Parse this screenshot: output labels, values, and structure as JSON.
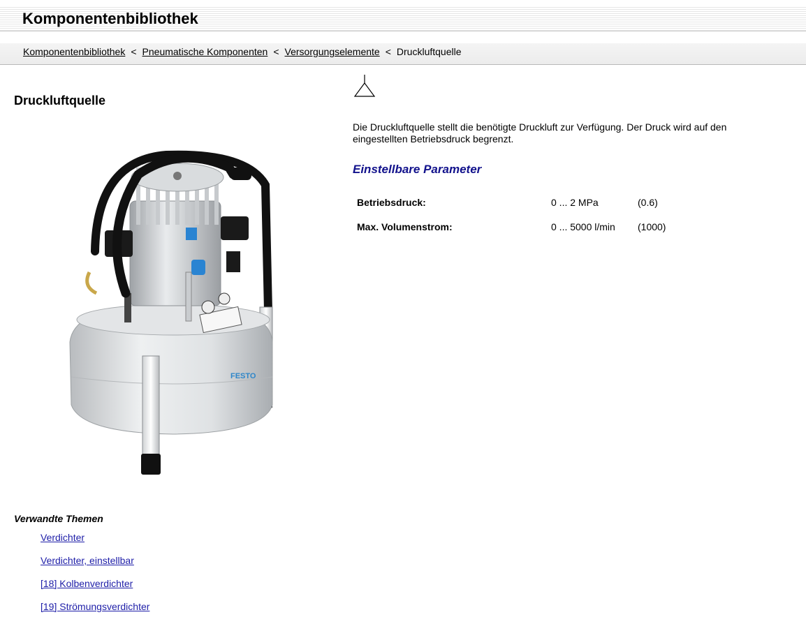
{
  "header": {
    "title": "Komponentenbibliothek"
  },
  "breadcrumb": {
    "items": [
      "Komponentenbibliothek",
      "Pneumatische Komponenten",
      "Versorgungselemente"
    ],
    "separator": "<",
    "current": "Druckluftquelle"
  },
  "page": {
    "title": "Druckluftquelle",
    "image_brand_text": "FESTO",
    "description": "Die Druckluftquelle stellt die benötigte Druckluft zur Verfügung. Der Druck wird auf den eingestellten Betriebsdruck begrenzt."
  },
  "params": {
    "heading": "Einstellbare Parameter",
    "rows": [
      {
        "name": "Betriebsdruck:",
        "range": "0 ... 2 MPa",
        "default": "(0.6)"
      },
      {
        "name": "Max. Volumenstrom:",
        "range": "0 ... 5000 l/min",
        "default": "(1000)"
      }
    ]
  },
  "related": {
    "heading": "Verwandte Themen",
    "links": [
      "Verdichter",
      "Verdichter, einstellbar",
      "[18]  Kolbenverdichter",
      "[19]  Strömungsverdichter"
    ]
  },
  "colors": {
    "link": "#1e1ea8",
    "param_heading": "#12128c"
  },
  "icons": {
    "symbol": "compressed-air-source-symbol"
  }
}
